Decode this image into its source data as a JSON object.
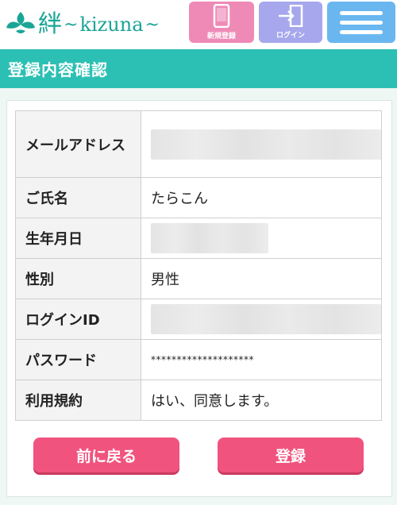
{
  "header": {
    "logo_kanji": "絆",
    "logo_tilde_left": "~",
    "logo_word": "kizuna",
    "logo_tilde_right": "~",
    "register_label": "新規登録",
    "login_label": "ログイン"
  },
  "page_title": "登録内容確認",
  "table": {
    "rows": [
      {
        "label": "メールアドレス",
        "value": ""
      },
      {
        "label": "ご氏名",
        "value": "たらこん"
      },
      {
        "label": "生年月日",
        "value": ""
      },
      {
        "label": "性別",
        "value": "男性"
      },
      {
        "label": "ログインID",
        "value": ""
      },
      {
        "label": "パスワード",
        "value": "********************"
      },
      {
        "label": "利用規約",
        "value": "はい、同意します。"
      }
    ]
  },
  "buttons": {
    "back": "前に戻る",
    "submit": "登録"
  },
  "colors": {
    "brand": "#1aa596",
    "title_bar": "#2cc0b4",
    "register_button": "#ef8ab7",
    "login_button": "#a6a7ec",
    "menu_button": "#6ab7f0",
    "action_button": "#f0547e"
  }
}
